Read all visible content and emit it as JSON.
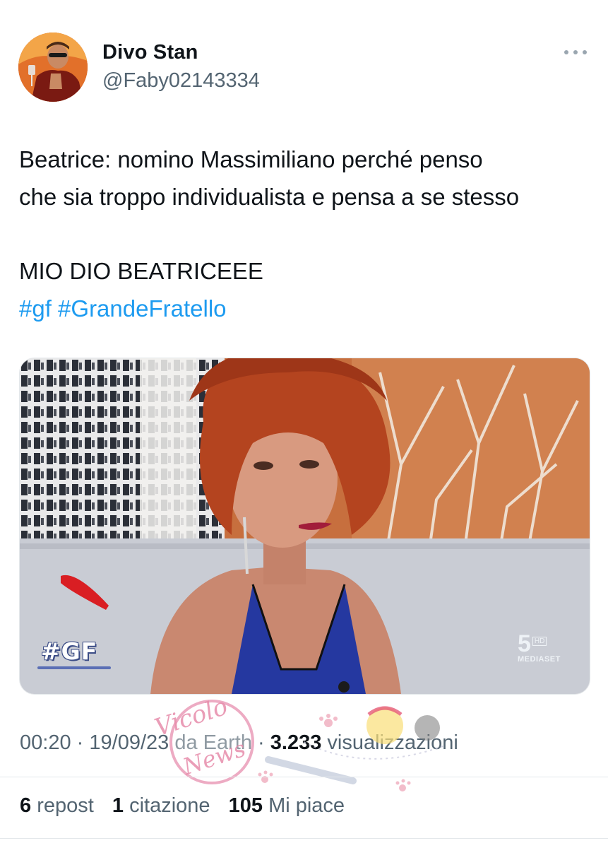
{
  "author": {
    "display_name": "Divo Stan",
    "handle": "@Faby02143334",
    "avatar_icon": "user-avatar-photo"
  },
  "tweet": {
    "lines": [
      "Beatrice: nomino Massimiliano perché penso",
      "che sia troppo individualista e pensa a se stesso",
      "MIO DIO BEATRICEEE"
    ],
    "hashtags": [
      "#gf",
      "#GrandeFratello"
    ]
  },
  "media": {
    "overlay_logo": "#GF",
    "channel_number": "5",
    "channel_hd": "HD",
    "channel_brand": "MEDIASET"
  },
  "meta": {
    "time": "00:20",
    "separator": "·",
    "date": "19/09/23",
    "source": "da Earth",
    "views_count": "3.233",
    "views_label": "visualizzazioni"
  },
  "stats": {
    "reposts_count": "6",
    "reposts_label": "repost",
    "quotes_count": "1",
    "quotes_label": "citazione",
    "likes_count": "105",
    "likes_label": "Mi piace"
  },
  "watermark": {
    "text_1": "Vicolo",
    "text_2": "News"
  },
  "colors": {
    "link": "#1d9bf0",
    "secondary_text": "#536471",
    "primary_text": "#0f1419",
    "divider": "#e4e8eb"
  }
}
